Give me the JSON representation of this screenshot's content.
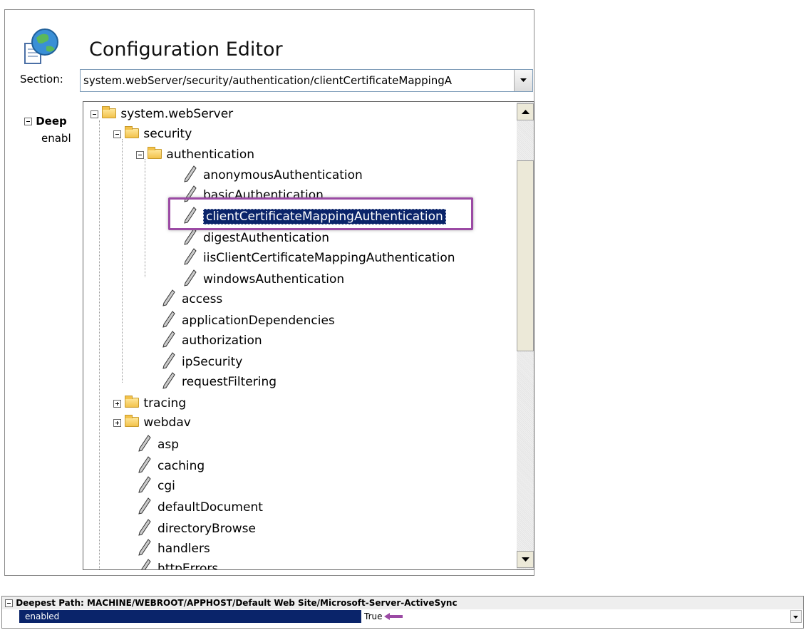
{
  "window": {
    "title": "Configuration Editor",
    "app_icon": "globe-document-icon"
  },
  "section": {
    "label": "Section:",
    "value": "system.webServer/security/authentication/clientCertificateMappingA"
  },
  "background_pane": {
    "header": "Deep",
    "row": "enabl"
  },
  "tree": {
    "root": "system.webServer",
    "security": "security",
    "authentication": "authentication",
    "auth_children": [
      "anonymousAuthentication",
      "basicAuthentication",
      "clientCertificateMappingAuthentication",
      "digestAuthentication",
      "iisClientCertificateMappingAuthentication",
      "windowsAuthentication"
    ],
    "security_children": [
      "access",
      "applicationDependencies",
      "authorization",
      "ipSecurity",
      "requestFiltering"
    ],
    "folders": [
      "tracing",
      "webdav"
    ],
    "root_children": [
      "asp",
      "caching",
      "cgi",
      "defaultDocument",
      "directoryBrowse",
      "handlers",
      "httpErrors"
    ],
    "selected": "clientCertificateMappingAuthentication"
  },
  "bottom": {
    "header": "Deepest Path: MACHINE/WEBROOT/APPHOST/Default Web Site/Microsoft-Server-ActiveSync",
    "property": "enabled",
    "value": "True"
  },
  "colors": {
    "selection": "#0a246a",
    "highlight": "#9b4aa4"
  }
}
